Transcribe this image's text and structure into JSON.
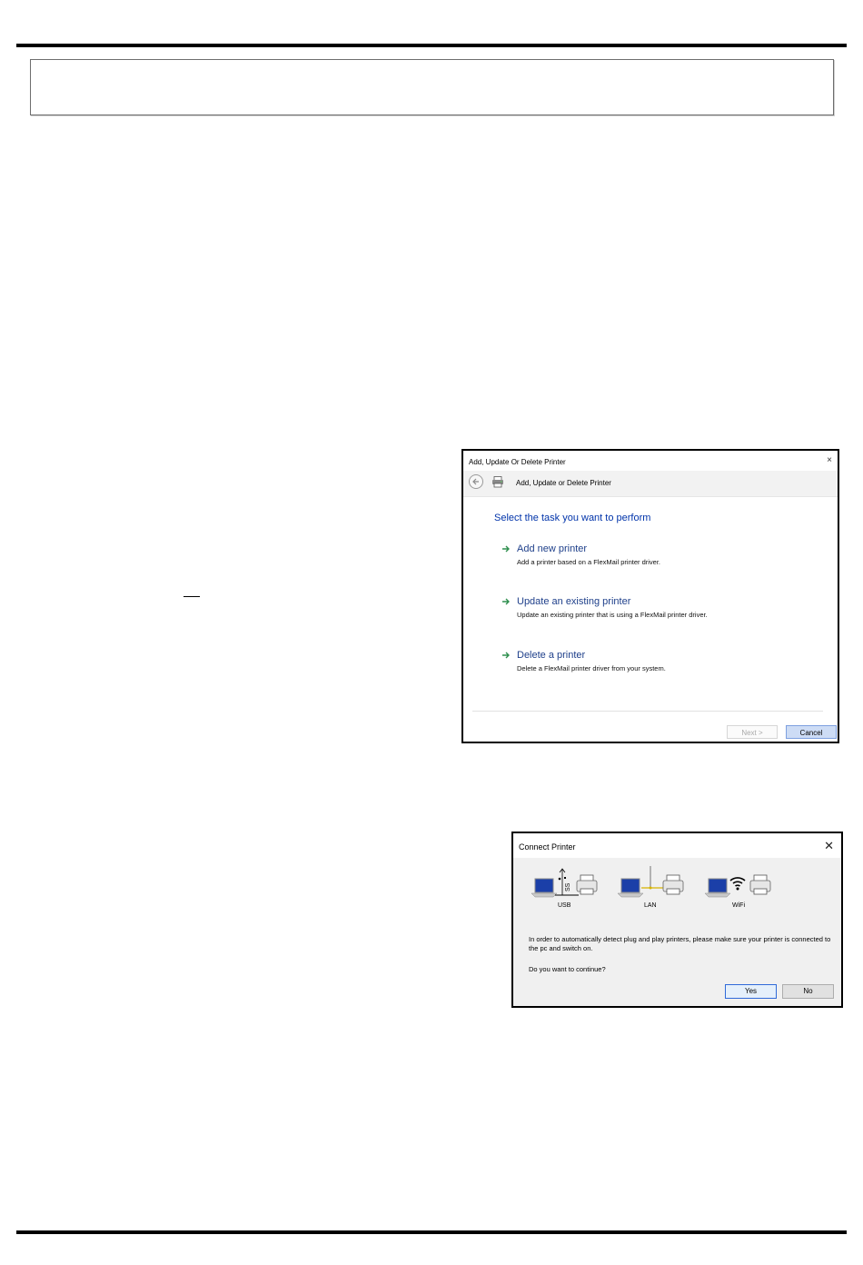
{
  "dialog_task": {
    "window_title": "Add, Update Or Delete Printer",
    "close_glyph": "×",
    "nav_title": "Add,  Update or Delete Printer",
    "heading": "Select the task you want to perform",
    "tasks": [
      {
        "title": "Add new printer",
        "description": "Add a printer based on a FlexMail printer driver."
      },
      {
        "title": "Update an existing printer",
        "description": "Update an existing printer that is using a FlexMail printer driver."
      },
      {
        "title": "Delete a printer",
        "description": "Delete a FlexMail printer driver from your system."
      }
    ],
    "next_label": "Next >",
    "cancel_label": "Cancel",
    "icons": {
      "back": "back-arrow-icon",
      "app": "printer-icon",
      "task": "green-arrow-icon"
    },
    "colors": {
      "heading": "#0033aa",
      "task_title": "#1e3f8a",
      "arrow": "#2f8f4e",
      "cancel_bg": "#cddcf5"
    }
  },
  "dialog_connect": {
    "window_title": "Connect Printer",
    "close_glyph": "✕",
    "connections": [
      {
        "label": "USB"
      },
      {
        "label": "LAN"
      },
      {
        "label": "WiFi"
      }
    ],
    "message": "In order to automatically detect plug and play printers, please make sure your printer is connected to the pc and switch on.",
    "question": "Do you want to continue?",
    "yes_label": "Yes",
    "no_label": "No",
    "colors": {
      "yes_border": "#2f6ad9",
      "lan_wire": "#d6b400",
      "laptop_screen": "#1b3fa8"
    }
  }
}
